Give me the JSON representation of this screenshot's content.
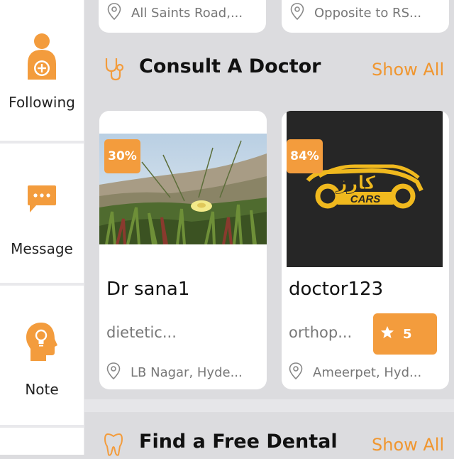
{
  "colors": {
    "accent": "#f39c3d",
    "accent_text": "#f0962f"
  },
  "sidebar": {
    "items": [
      {
        "label": "Following",
        "icon": "person-plus-icon"
      },
      {
        "label": "Message",
        "icon": "chat-bubble-icon"
      },
      {
        "label": "Note",
        "icon": "head-lightbulb-icon"
      }
    ]
  },
  "top_cards": [
    {
      "address": "All Saints Road,...",
      "icon": "location-pin-icon"
    },
    {
      "address": "Opposite to RS...",
      "icon": "location-pin-icon"
    }
  ],
  "consult_section": {
    "title": "Consult A Doctor",
    "show_all": "Show All",
    "icon": "stethoscope-icon",
    "doctors": [
      {
        "discount": "30%",
        "name": "Dr sana1",
        "specialty": "dietetic...",
        "address": "LB Nagar, Hyde...",
        "image": "beach-dune-photo"
      },
      {
        "discount": "84%",
        "name": "doctor123",
        "specialty": "orthop...",
        "address": "Ameerpet, Hyd...",
        "rating": "5",
        "image": "cars-logo",
        "logo_text": "CARS",
        "logo_script": "كارز"
      }
    ]
  },
  "dental_section": {
    "title": "Find a Free Dental",
    "show_all": "Show All",
    "icon": "tooth-icon"
  }
}
